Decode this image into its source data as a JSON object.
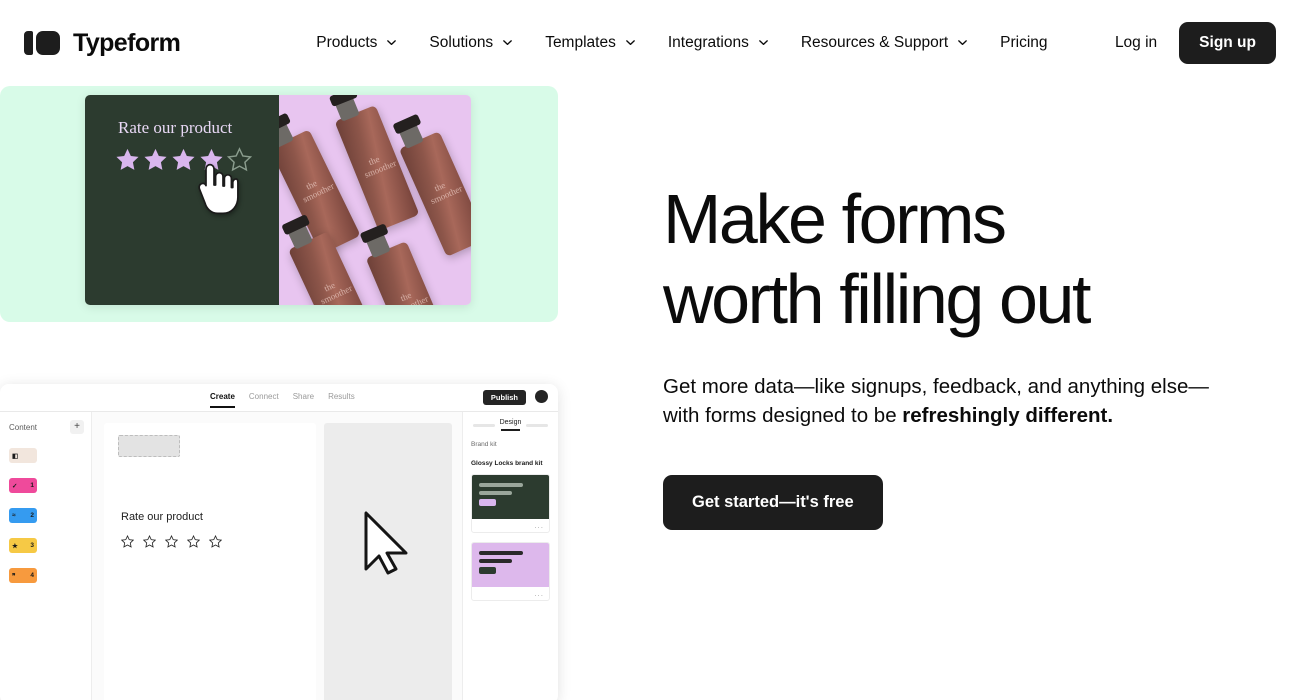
{
  "brand": {
    "name": "Typeform",
    "logo_icon": "typeform-logo-icon"
  },
  "nav": {
    "items": [
      {
        "label": "Products",
        "has_chevron": true
      },
      {
        "label": "Solutions",
        "has_chevron": true
      },
      {
        "label": "Templates",
        "has_chevron": true
      },
      {
        "label": "Integrations",
        "has_chevron": true
      },
      {
        "label": "Resources & Support",
        "has_chevron": true
      },
      {
        "label": "Pricing",
        "has_chevron": false
      }
    ],
    "login_label": "Log in",
    "signup_label": "Sign up"
  },
  "hero": {
    "headline_line1": "Make forms",
    "headline_line2": "worth filling out",
    "subhead_text": "Get more data—like signups, feedback, and anything else—with forms designed to be ",
    "subhead_bold": "refreshingly different.",
    "cta_label": "Get started—it's free"
  },
  "rating_card": {
    "question": "Rate our product",
    "stars_filled": 4,
    "stars_total": 5,
    "bg_color": "#d8fbe8",
    "panel_color": "#2c3b2f",
    "star_color": "#d9b6ee",
    "photo_bg": "#e8c5f0",
    "product_label": "the smoother",
    "cursor_icon": "pointing-hand-cursor-icon"
  },
  "builder_card": {
    "tabs": [
      {
        "label": "Create",
        "active": true
      },
      {
        "label": "Connect",
        "active": false
      },
      {
        "label": "Share",
        "active": false
      },
      {
        "label": "Results",
        "active": false
      }
    ],
    "publish_label": "Publish",
    "avatar_icon": "user-avatar-icon",
    "sidebar": {
      "title": "Content",
      "add_icon": "plus-icon",
      "items": [
        {
          "number": "",
          "glyph": "◧",
          "color": "#f2e6dd"
        },
        {
          "number": "1",
          "glyph": "✓",
          "color": "#ef4a9b"
        },
        {
          "number": "2",
          "glyph": "≈",
          "color": "#359bf0"
        },
        {
          "number": "3",
          "glyph": "★",
          "color": "#f6c945"
        },
        {
          "number": "4",
          "glyph": "❞",
          "color": "#f79a3e"
        }
      ]
    },
    "canvas": {
      "question": "Rate our product",
      "stars_total": 5,
      "cursor_icon": "arrow-cursor-icon"
    },
    "design_panel": {
      "tab_label": "Design",
      "section_label": "Brand kit",
      "kit_name": "Glossy Locks brand kit",
      "themes": [
        {
          "bg": "#2c3b2f",
          "line1": "#9aa69b",
          "line2": "#9aa69b",
          "button": "#d9b6ee",
          "more": "..."
        },
        {
          "bg": "#ddb8ec",
          "line1": "#2a2a2a",
          "line2": "#2a2a2a",
          "button": "#2c3b2f",
          "more": "..."
        }
      ]
    }
  }
}
